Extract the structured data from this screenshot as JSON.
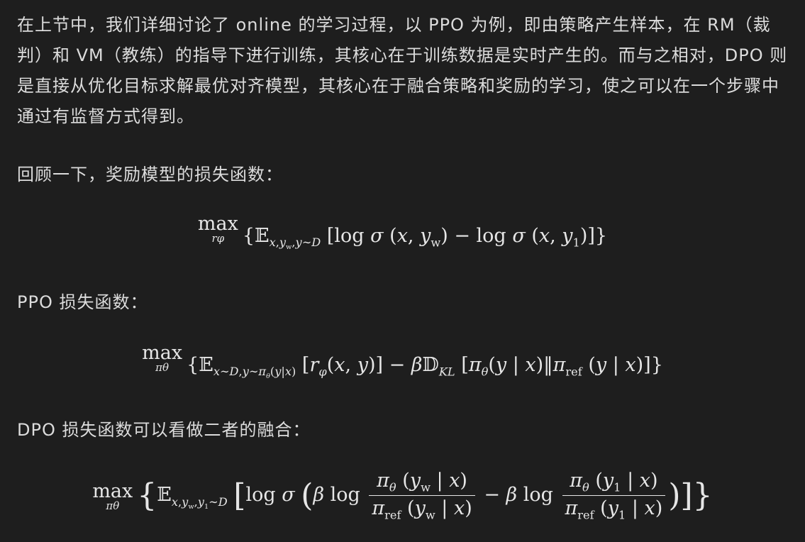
{
  "intro_paragraph": "在上节中，我们详细讨论了 online 的学习过程，以 PPO 为例，即由策略产生样本，在 RM（裁判）和 VM（教练）的指导下进行训练，其核心在于训练数据是实时产生的。而与之相对，DPO 则是直接从优化目标求解最优对齐模型，其核心在于融合策略和奖励的学习，使之可以在一个步骤中通过有监督方式得到。",
  "reward_label": "回顾一下，奖励模型的损失函数：",
  "ppo_label": "PPO 损失函数：",
  "dpo_label": "DPO 损失函数可以看做二者的融合：",
  "eq_reward": {
    "op": "max",
    "op_sub": "rφ",
    "body": "{𝔼x,yw,y∼D [log σ (x, yw) − log σ (x, y1)]}"
  },
  "eq_ppo": {
    "op": "max",
    "op_sub": "πθ",
    "body": "{𝔼x∼D,y∼πθ(y|x) [rφ(x, y)] − β𝔻KL [πθ(y | x)‖πref (y | x)]}"
  },
  "eq_dpo": {
    "op": "max",
    "op_sub": "πθ",
    "body": "{𝔼x,yw,y1∼D [log σ (β log πθ(yw | x)/πref(yw | x) − β log πθ(y1 | x)/πref(y1 | x))]}"
  }
}
